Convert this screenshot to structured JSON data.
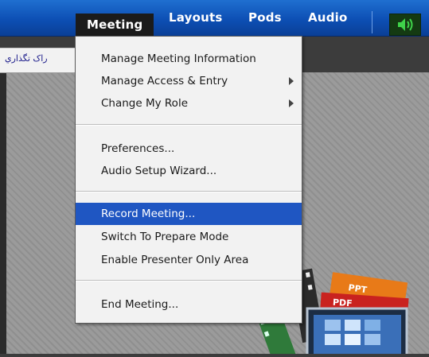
{
  "menubar": {
    "items": [
      {
        "label": "Meeting"
      },
      {
        "label": "Layouts"
      },
      {
        "label": "Pods"
      },
      {
        "label": "Audio"
      }
    ],
    "audio_icon": "speaker-icon"
  },
  "left_panel": {
    "label": "راک تگذاري"
  },
  "meeting_menu": {
    "items": [
      {
        "label": "Manage Meeting Information",
        "has_submenu": false
      },
      {
        "label": "Manage Access & Entry",
        "has_submenu": true
      },
      {
        "label": "Change My Role",
        "has_submenu": true
      },
      {
        "label": "Preferences...",
        "has_submenu": false
      },
      {
        "label": "Audio Setup Wizard...",
        "has_submenu": false
      },
      {
        "label": "Record Meeting...",
        "has_submenu": false,
        "highlighted": true
      },
      {
        "label": "Switch To Prepare Mode",
        "has_submenu": false
      },
      {
        "label": "Enable Presenter Only Area",
        "has_submenu": false
      },
      {
        "label": "End Meeting...",
        "has_submenu": false
      }
    ]
  },
  "deco": {
    "ppt_label": "PPT",
    "pdf_label": "PDF"
  },
  "colors": {
    "menubar": "#0d4fb4",
    "highlight": "#1f56c2",
    "audio_green": "#3fd34a"
  }
}
